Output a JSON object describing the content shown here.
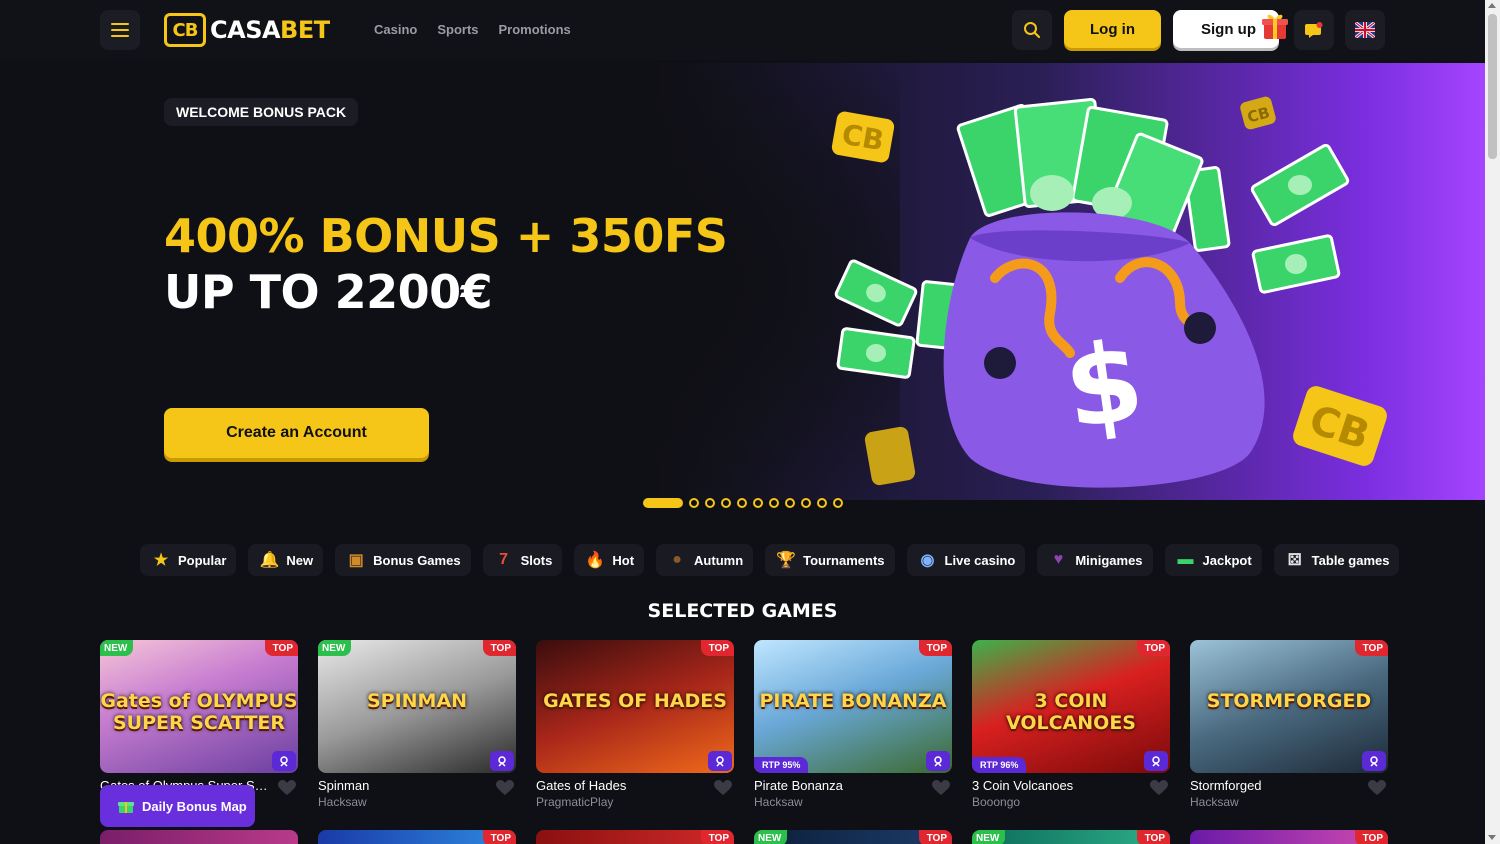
{
  "header": {
    "logo_mark": "CB",
    "logo_casa": "CASA",
    "logo_bet": "BET",
    "nav": [
      "Casino",
      "Sports",
      "Promotions"
    ],
    "login_label": "Log in",
    "signup_label": "Sign up"
  },
  "hero": {
    "badge": "WELCOME BONUS PACK",
    "line1": "400% BONUS + 350FS",
    "line2": "UP TO 2200€",
    "cta": "Create an Account",
    "slides_total": 11,
    "active_slide": 1
  },
  "categories": [
    {
      "label": "Popular",
      "icon": "star-icon",
      "glyph": "★",
      "color": "#f5c518"
    },
    {
      "label": "New",
      "icon": "bell-icon",
      "glyph": "🔔",
      "color": "#f5a623"
    },
    {
      "label": "Bonus Games",
      "icon": "treasure-chest-icon",
      "glyph": "▣",
      "color": "#d08a2a"
    },
    {
      "label": "Slots",
      "icon": "slot-machine-icon",
      "glyph": "7",
      "color": "#e74c3c"
    },
    {
      "label": "Hot",
      "icon": "flame-icon",
      "glyph": "🔥",
      "color": "#ff5722"
    },
    {
      "label": "Autumn",
      "icon": "acorn-icon",
      "glyph": "●",
      "color": "#8b5a2b"
    },
    {
      "label": "Tournaments",
      "icon": "trophy-icon",
      "glyph": "🏆",
      "color": "#f5c518"
    },
    {
      "label": "Live casino",
      "icon": "crystal-ball-icon",
      "glyph": "◉",
      "color": "#7fb3ff"
    },
    {
      "label": "Minigames",
      "icon": "heart-gem-icon",
      "glyph": "♥",
      "color": "#8e44ad"
    },
    {
      "label": "Jackpot",
      "icon": "cash-icon",
      "glyph": "▬",
      "color": "#3ad46a"
    },
    {
      "label": "Table games",
      "icon": "dice-icon",
      "glyph": "⚄",
      "color": "#e0e0e0"
    }
  ],
  "section_title": "SELECTED GAMES",
  "games": [
    {
      "name": "Gates of Olympus Super Sc...",
      "provider": "",
      "thumb_title": "Gates of OLYMPUS SUPER SCATTER",
      "new": "NEW",
      "top": "TOP",
      "rtp": "",
      "bg": "linear-gradient(160deg,#f7c6d8 0%,#c77dd0 40%,#6b3fa0 100%)"
    },
    {
      "name": "Spinman",
      "provider": "Hacksaw",
      "thumb_title": "SPINMAN",
      "new": "NEW",
      "top": "TOP",
      "rtp": "",
      "bg": "linear-gradient(160deg,#e9e9e9 0%,#9a9a9a 50%,#2a2a2a 100%)"
    },
    {
      "name": "Gates of Hades",
      "provider": "PragmaticPlay",
      "thumb_title": "GATES OF HADES",
      "new": "",
      "top": "TOP",
      "rtp": "",
      "bg": "linear-gradient(160deg,#3a0d0d 0%,#a8261a 50%,#f06a1a 100%)"
    },
    {
      "name": "Pirate Bonanza",
      "provider": "Hacksaw",
      "thumb_title": "PIRATE BONANZA",
      "new": "",
      "top": "TOP",
      "rtp": "RTP 95%",
      "bg": "linear-gradient(160deg,#bfe6ff 0%,#6aa8d8 45%,#3b6a2f 100%)"
    },
    {
      "name": "3 Coin Volcanoes",
      "provider": "Booongo",
      "thumb_title": "3 COIN VOLCANOES",
      "new": "",
      "top": "TOP",
      "rtp": "RTP 96%",
      "bg": "linear-gradient(160deg,#3bb34a 0%,#d92020 45%,#7a0a0a 100%)"
    },
    {
      "name": "Stormforged",
      "provider": "Hacksaw",
      "thumb_title": "STORMFORGED",
      "new": "",
      "top": "TOP",
      "rtp": "",
      "bg": "linear-gradient(160deg,#9cc3d8 0%,#4a6a80 50%,#1d2a38 100%)"
    }
  ],
  "games_row2": [
    {
      "new": "",
      "top": "",
      "bg": "linear-gradient(90deg,#7a1e6a,#b93a8a)"
    },
    {
      "new": "",
      "top": "TOP",
      "bg": "linear-gradient(90deg,#1a3aa8,#2e8ae0)"
    },
    {
      "new": "",
      "top": "TOP",
      "bg": "linear-gradient(90deg,#8a1010,#d22a2a)"
    },
    {
      "new": "NEW",
      "top": "TOP",
      "bg": "linear-gradient(90deg,#0c1f3a,#1d3c6a)"
    },
    {
      "new": "NEW",
      "top": "TOP",
      "bg": "linear-gradient(90deg,#0e6a5a,#2cb08a)"
    },
    {
      "new": "",
      "top": "TOP",
      "bg": "linear-gradient(90deg,#6a1aa8,#d04ab0)"
    }
  ],
  "daily_bonus": "Daily Bonus Map",
  "colors": {
    "accent": "#f5c518",
    "purple": "#6a2fdc",
    "bg": "#0f1015"
  }
}
